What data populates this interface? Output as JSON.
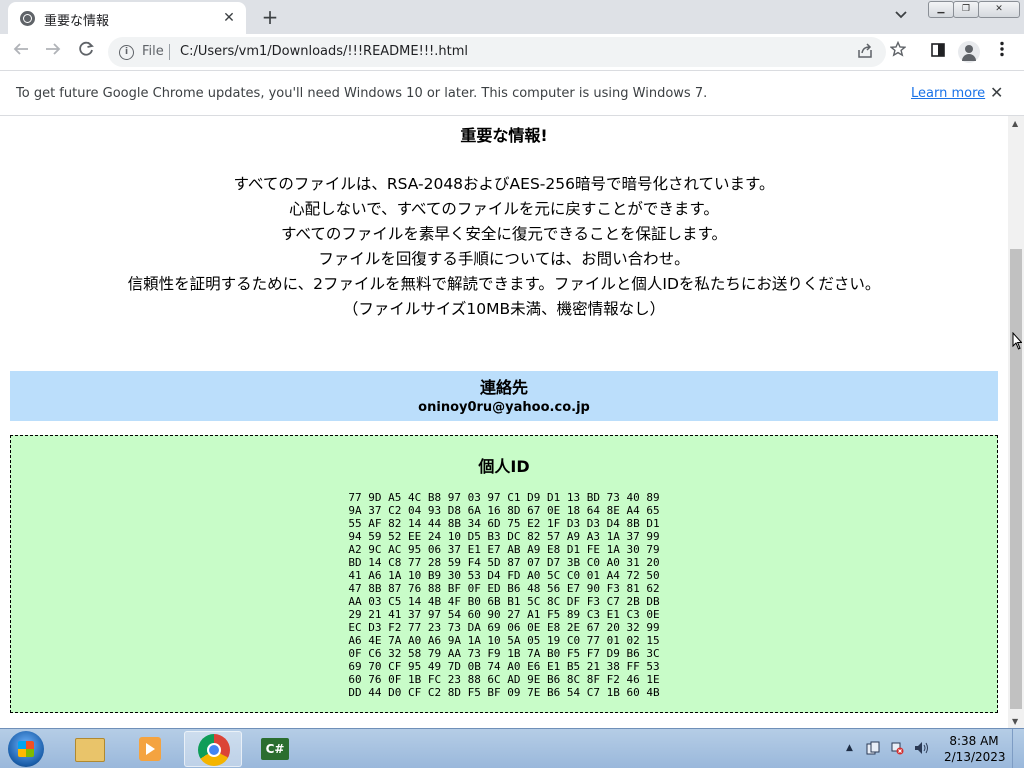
{
  "browser": {
    "tab_title": "重要な情報",
    "tab_close": "✕",
    "new_tab": "+",
    "file_label": "File",
    "url": "C:/Users/vm1/Downloads/!!!README!!!.html",
    "info_text": "To get future Google Chrome updates, you'll need Windows 10 or later. This computer is using Windows 7.",
    "learn_more": "Learn more",
    "info_close": "✕"
  },
  "page": {
    "heading": "重要な情報!",
    "messages": [
      "すべてのファイルは、RSA-2048およびAES-256暗号で暗号化されています。",
      "心配しないで、すべてのファイルを元に戻すことができます。",
      "すべてのファイルを素早く安全に復元できることを保証します。",
      "ファイルを回復する手順については、お問い合わせ。",
      "信頼性を証明するために、2ファイルを無料で解読できます。ファイルと個人IDを私たちにお送りください。",
      "（ファイルサイズ10MB未満、機密情報なし）"
    ],
    "contact": {
      "title": "連絡先",
      "email": "oninoy0ru@yahoo.co.jp"
    },
    "personal_id": {
      "title": "個人ID",
      "lines": [
        "77 9D A5 4C B8 97 03 97 C1 D9 D1 13 BD 73 40 89",
        "9A 37 C2 04 93 D8 6A 16 8D 67 0E 18 64 8E A4 65",
        "55 AF 82 14 44 8B 34 6D 75 E2 1F D3 D3 D4 8B D1",
        "94 59 52 EE 24 10 D5 B3 DC 82 57 A9 A3 1A 37 99",
        "A2 9C AC 95 06 37 E1 E7 AB A9 E8 D1 FE 1A 30 79",
        "BD 14 C8 77 28 59 F4 5D 87 07 D7 3B C0 A0 31 20",
        "41 A6 1A 10 B9 30 53 D4 FD A0 5C C0 01 A4 72 50",
        "47 8B 87 76 88 BF 0F ED B6 48 56 E7 90 F3 81 62",
        "AA 03 C5 14 4B 4F B0 6B B1 5C 8C DF F3 C7 2B DB",
        "29 21 41 37 97 54 60 90 27 A1 F5 89 C3 E1 C3 0E",
        "EC D3 F2 77 23 73 DA 69 06 0E E8 2E 67 20 32 99",
        "A6 4E 7A A0 A6 9A 1A 10 5A 05 19 C0 77 01 02 15",
        "0F C6 32 58 79 AA 73 F9 1B 7A B0 F5 F7 D9 B6 3C",
        "69 70 CF 95 49 7D 0B 74 A0 E6 E1 B5 21 38 FF 53",
        "60 76 0F 1B FC 23 88 6C AD 9E B6 8C 8F F2 46 1E",
        "DD 44 D0 CF C2 8D F5 BF 09 7E B6 54 C7 1B 60 4B"
      ]
    }
  },
  "taskbar": {
    "time": "8:38 AM",
    "date": "2/13/2023",
    "cs_label": "C#"
  },
  "colors": {
    "contact_bg": "#bbdefb",
    "id_bg": "#c8fcc8",
    "link": "#1a73e8"
  },
  "icons": [
    "globe-icon",
    "close-icon",
    "plus-icon",
    "chevron-down-icon",
    "back-arrow-icon",
    "forward-arrow-icon",
    "reload-icon",
    "info-icon",
    "share-icon",
    "star-icon",
    "sidepanel-icon",
    "profile-icon",
    "kebab-menu-icon"
  ]
}
